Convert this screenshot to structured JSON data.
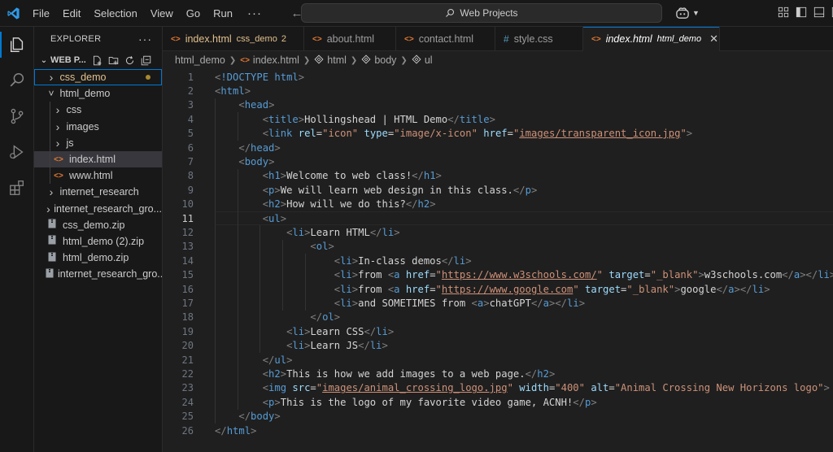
{
  "menu": {
    "items": [
      "File",
      "Edit",
      "Selection",
      "View",
      "Go",
      "Run"
    ],
    "more": "···"
  },
  "search": {
    "label": "Web Projects"
  },
  "explorer": {
    "title": "EXPLORER",
    "more": "···",
    "workspace": "WEB P...",
    "tree": [
      {
        "label": "css_demo",
        "kind": "folder",
        "depth": 0,
        "open": false,
        "modified": true,
        "focused": true
      },
      {
        "label": "html_demo",
        "kind": "folder",
        "depth": 0,
        "open": true
      },
      {
        "label": "css",
        "kind": "folder",
        "depth": 1,
        "open": false
      },
      {
        "label": "images",
        "kind": "folder",
        "depth": 1,
        "open": false
      },
      {
        "label": "js",
        "kind": "folder",
        "depth": 1,
        "open": false
      },
      {
        "label": "index.html",
        "kind": "html",
        "depth": 1,
        "selected": true
      },
      {
        "label": "www.html",
        "kind": "html",
        "depth": 1
      },
      {
        "label": "internet_research",
        "kind": "folder",
        "depth": 0,
        "open": false
      },
      {
        "label": "internet_research_gro...",
        "kind": "folder",
        "depth": 0,
        "open": false
      },
      {
        "label": "css_demo.zip",
        "kind": "zip",
        "depth": 0
      },
      {
        "label": "html_demo (2).zip",
        "kind": "zip",
        "depth": 0
      },
      {
        "label": "html_demo.zip",
        "kind": "zip",
        "depth": 0
      },
      {
        "label": "internet_research_gro...",
        "kind": "zip",
        "depth": 0
      }
    ]
  },
  "tabs": [
    {
      "label": "index.html",
      "desc": "css_demo",
      "badge": "2",
      "icon": "html",
      "modified": true
    },
    {
      "label": "about.html",
      "icon": "html"
    },
    {
      "label": "contact.html",
      "icon": "html"
    },
    {
      "label": "style.css",
      "icon": "css"
    },
    {
      "label": "index.html",
      "desc": "html_demo",
      "icon": "html",
      "active": true
    }
  ],
  "breadcrumb": [
    {
      "label": "html_demo",
      "icon": ""
    },
    {
      "label": "index.html",
      "icon": "html"
    },
    {
      "label": "html",
      "icon": "tag"
    },
    {
      "label": "body",
      "icon": "tag"
    },
    {
      "label": "ul",
      "icon": "tag"
    }
  ],
  "editor": {
    "current_line": 11,
    "lines": [
      [
        [
          "br",
          "<"
        ],
        [
          "tag",
          "!DOCTYPE"
        ],
        [
          "txt",
          " "
        ],
        [
          "tag",
          "html"
        ],
        [
          "br",
          ">"
        ]
      ],
      [
        [
          "br",
          "<"
        ],
        [
          "tag",
          "html"
        ],
        [
          "br",
          ">"
        ]
      ],
      [
        [
          "txt",
          "    "
        ],
        [
          "br",
          "<"
        ],
        [
          "tag",
          "head"
        ],
        [
          "br",
          ">"
        ]
      ],
      [
        [
          "txt",
          "        "
        ],
        [
          "br",
          "<"
        ],
        [
          "tag",
          "title"
        ],
        [
          "br",
          ">"
        ],
        [
          "txt",
          "Hollingshead | HTML Demo"
        ],
        [
          "br",
          "</"
        ],
        [
          "tag",
          "title"
        ],
        [
          "br",
          ">"
        ]
      ],
      [
        [
          "txt",
          "        "
        ],
        [
          "br",
          "<"
        ],
        [
          "tag",
          "link"
        ],
        [
          "txt",
          " "
        ],
        [
          "attr",
          "rel"
        ],
        [
          "eq",
          "="
        ],
        [
          "str",
          "\"icon\""
        ],
        [
          "txt",
          " "
        ],
        [
          "attr",
          "type"
        ],
        [
          "eq",
          "="
        ],
        [
          "str",
          "\"image/x-icon\""
        ],
        [
          "txt",
          " "
        ],
        [
          "attr",
          "href"
        ],
        [
          "eq",
          "="
        ],
        [
          "str",
          "\""
        ],
        [
          "link",
          "images/transparent_icon.jpg"
        ],
        [
          "str",
          "\""
        ],
        [
          "br",
          ">"
        ]
      ],
      [
        [
          "txt",
          "    "
        ],
        [
          "br",
          "</"
        ],
        [
          "tag",
          "head"
        ],
        [
          "br",
          ">"
        ]
      ],
      [
        [
          "txt",
          "    "
        ],
        [
          "br",
          "<"
        ],
        [
          "tag",
          "body"
        ],
        [
          "br",
          ">"
        ]
      ],
      [
        [
          "txt",
          "        "
        ],
        [
          "br",
          "<"
        ],
        [
          "tag",
          "h1"
        ],
        [
          "br",
          ">"
        ],
        [
          "txt",
          "Welcome to web class!"
        ],
        [
          "br",
          "</"
        ],
        [
          "tag",
          "h1"
        ],
        [
          "br",
          ">"
        ]
      ],
      [
        [
          "txt",
          "        "
        ],
        [
          "br",
          "<"
        ],
        [
          "tag",
          "p"
        ],
        [
          "br",
          ">"
        ],
        [
          "txt",
          "We will learn web design in this class."
        ],
        [
          "br",
          "</"
        ],
        [
          "tag",
          "p"
        ],
        [
          "br",
          ">"
        ]
      ],
      [
        [
          "txt",
          "        "
        ],
        [
          "br",
          "<"
        ],
        [
          "tag",
          "h2"
        ],
        [
          "br",
          ">"
        ],
        [
          "txt",
          "How will we do this?"
        ],
        [
          "br",
          "</"
        ],
        [
          "tag",
          "h2"
        ],
        [
          "br",
          ">"
        ]
      ],
      [
        [
          "txt",
          "        "
        ],
        [
          "br",
          "<"
        ],
        [
          "tag",
          "ul"
        ],
        [
          "br",
          ">"
        ]
      ],
      [
        [
          "txt",
          "            "
        ],
        [
          "br",
          "<"
        ],
        [
          "tag",
          "li"
        ],
        [
          "br",
          ">"
        ],
        [
          "txt",
          "Learn HTML"
        ],
        [
          "br",
          "</"
        ],
        [
          "tag",
          "li"
        ],
        [
          "br",
          ">"
        ]
      ],
      [
        [
          "txt",
          "                "
        ],
        [
          "br",
          "<"
        ],
        [
          "tag",
          "ol"
        ],
        [
          "br",
          ">"
        ]
      ],
      [
        [
          "txt",
          "                    "
        ],
        [
          "br",
          "<"
        ],
        [
          "tag",
          "li"
        ],
        [
          "br",
          ">"
        ],
        [
          "txt",
          "In-class demos"
        ],
        [
          "br",
          "</"
        ],
        [
          "tag",
          "li"
        ],
        [
          "br",
          ">"
        ]
      ],
      [
        [
          "txt",
          "                    "
        ],
        [
          "br",
          "<"
        ],
        [
          "tag",
          "li"
        ],
        [
          "br",
          ">"
        ],
        [
          "txt",
          "from "
        ],
        [
          "br",
          "<"
        ],
        [
          "tag",
          "a"
        ],
        [
          "txt",
          " "
        ],
        [
          "attr",
          "href"
        ],
        [
          "eq",
          "="
        ],
        [
          "str",
          "\""
        ],
        [
          "link",
          "https://www.w3schools.com/"
        ],
        [
          "str",
          "\""
        ],
        [
          "txt",
          " "
        ],
        [
          "attr",
          "target"
        ],
        [
          "eq",
          "="
        ],
        [
          "str",
          "\"_blank\""
        ],
        [
          "br",
          ">"
        ],
        [
          "txt",
          "w3schools.com"
        ],
        [
          "br",
          "</"
        ],
        [
          "tag",
          "a"
        ],
        [
          "br",
          "></"
        ],
        [
          "tag",
          "li"
        ],
        [
          "br",
          ">"
        ]
      ],
      [
        [
          "txt",
          "                    "
        ],
        [
          "br",
          "<"
        ],
        [
          "tag",
          "li"
        ],
        [
          "br",
          ">"
        ],
        [
          "txt",
          "from "
        ],
        [
          "br",
          "<"
        ],
        [
          "tag",
          "a"
        ],
        [
          "txt",
          " "
        ],
        [
          "attr",
          "href"
        ],
        [
          "eq",
          "="
        ],
        [
          "str",
          "\""
        ],
        [
          "link",
          "https://www.google.com"
        ],
        [
          "str",
          "\""
        ],
        [
          "txt",
          " "
        ],
        [
          "attr",
          "target"
        ],
        [
          "eq",
          "="
        ],
        [
          "str",
          "\"_blank\""
        ],
        [
          "br",
          ">"
        ],
        [
          "txt",
          "google"
        ],
        [
          "br",
          "</"
        ],
        [
          "tag",
          "a"
        ],
        [
          "br",
          "></"
        ],
        [
          "tag",
          "li"
        ],
        [
          "br",
          ">"
        ]
      ],
      [
        [
          "txt",
          "                    "
        ],
        [
          "br",
          "<"
        ],
        [
          "tag",
          "li"
        ],
        [
          "br",
          ">"
        ],
        [
          "txt",
          "and SOMETIMES from "
        ],
        [
          "br",
          "<"
        ],
        [
          "tag",
          "a"
        ],
        [
          "br",
          ">"
        ],
        [
          "txt",
          "chatGPT"
        ],
        [
          "br",
          "</"
        ],
        [
          "tag",
          "a"
        ],
        [
          "br",
          "></"
        ],
        [
          "tag",
          "li"
        ],
        [
          "br",
          ">"
        ]
      ],
      [
        [
          "txt",
          "                "
        ],
        [
          "br",
          "</"
        ],
        [
          "tag",
          "ol"
        ],
        [
          "br",
          ">"
        ]
      ],
      [
        [
          "txt",
          "            "
        ],
        [
          "br",
          "<"
        ],
        [
          "tag",
          "li"
        ],
        [
          "br",
          ">"
        ],
        [
          "txt",
          "Learn CSS"
        ],
        [
          "br",
          "</"
        ],
        [
          "tag",
          "li"
        ],
        [
          "br",
          ">"
        ]
      ],
      [
        [
          "txt",
          "            "
        ],
        [
          "br",
          "<"
        ],
        [
          "tag",
          "li"
        ],
        [
          "br",
          ">"
        ],
        [
          "txt",
          "Learn JS"
        ],
        [
          "br",
          "</"
        ],
        [
          "tag",
          "li"
        ],
        [
          "br",
          ">"
        ]
      ],
      [
        [
          "txt",
          "        "
        ],
        [
          "br",
          "</"
        ],
        [
          "tag",
          "ul"
        ],
        [
          "br",
          ">"
        ]
      ],
      [
        [
          "txt",
          "        "
        ],
        [
          "br",
          "<"
        ],
        [
          "tag",
          "h2"
        ],
        [
          "br",
          ">"
        ],
        [
          "txt",
          "This is how we add images to a web page."
        ],
        [
          "br",
          "</"
        ],
        [
          "tag",
          "h2"
        ],
        [
          "br",
          ">"
        ]
      ],
      [
        [
          "txt",
          "        "
        ],
        [
          "br",
          "<"
        ],
        [
          "tag",
          "img"
        ],
        [
          "txt",
          " "
        ],
        [
          "attr",
          "src"
        ],
        [
          "eq",
          "="
        ],
        [
          "str",
          "\""
        ],
        [
          "link",
          "images/animal_crossing_logo.jpg"
        ],
        [
          "str",
          "\""
        ],
        [
          "txt",
          " "
        ],
        [
          "attr",
          "width"
        ],
        [
          "eq",
          "="
        ],
        [
          "str",
          "\"400\""
        ],
        [
          "txt",
          " "
        ],
        [
          "attr",
          "alt"
        ],
        [
          "eq",
          "="
        ],
        [
          "str",
          "\"Animal Crossing New Horizons logo\""
        ],
        [
          "br",
          ">"
        ]
      ],
      [
        [
          "txt",
          "        "
        ],
        [
          "br",
          "<"
        ],
        [
          "tag",
          "p"
        ],
        [
          "br",
          ">"
        ],
        [
          "txt",
          "This is the logo of my favorite video game, ACNH!"
        ],
        [
          "br",
          "</"
        ],
        [
          "tag",
          "p"
        ],
        [
          "br",
          ">"
        ]
      ],
      [
        [
          "txt",
          "    "
        ],
        [
          "br",
          "</"
        ],
        [
          "tag",
          "body"
        ],
        [
          "br",
          ">"
        ]
      ],
      [
        [
          "br",
          "</"
        ],
        [
          "tag",
          "html"
        ],
        [
          "br",
          ">"
        ]
      ]
    ]
  },
  "colors": {
    "accent": "#0078d4",
    "tag": "#569cd6",
    "attr": "#9cdcfe",
    "string": "#ce9178",
    "modified": "#e2c08d"
  }
}
